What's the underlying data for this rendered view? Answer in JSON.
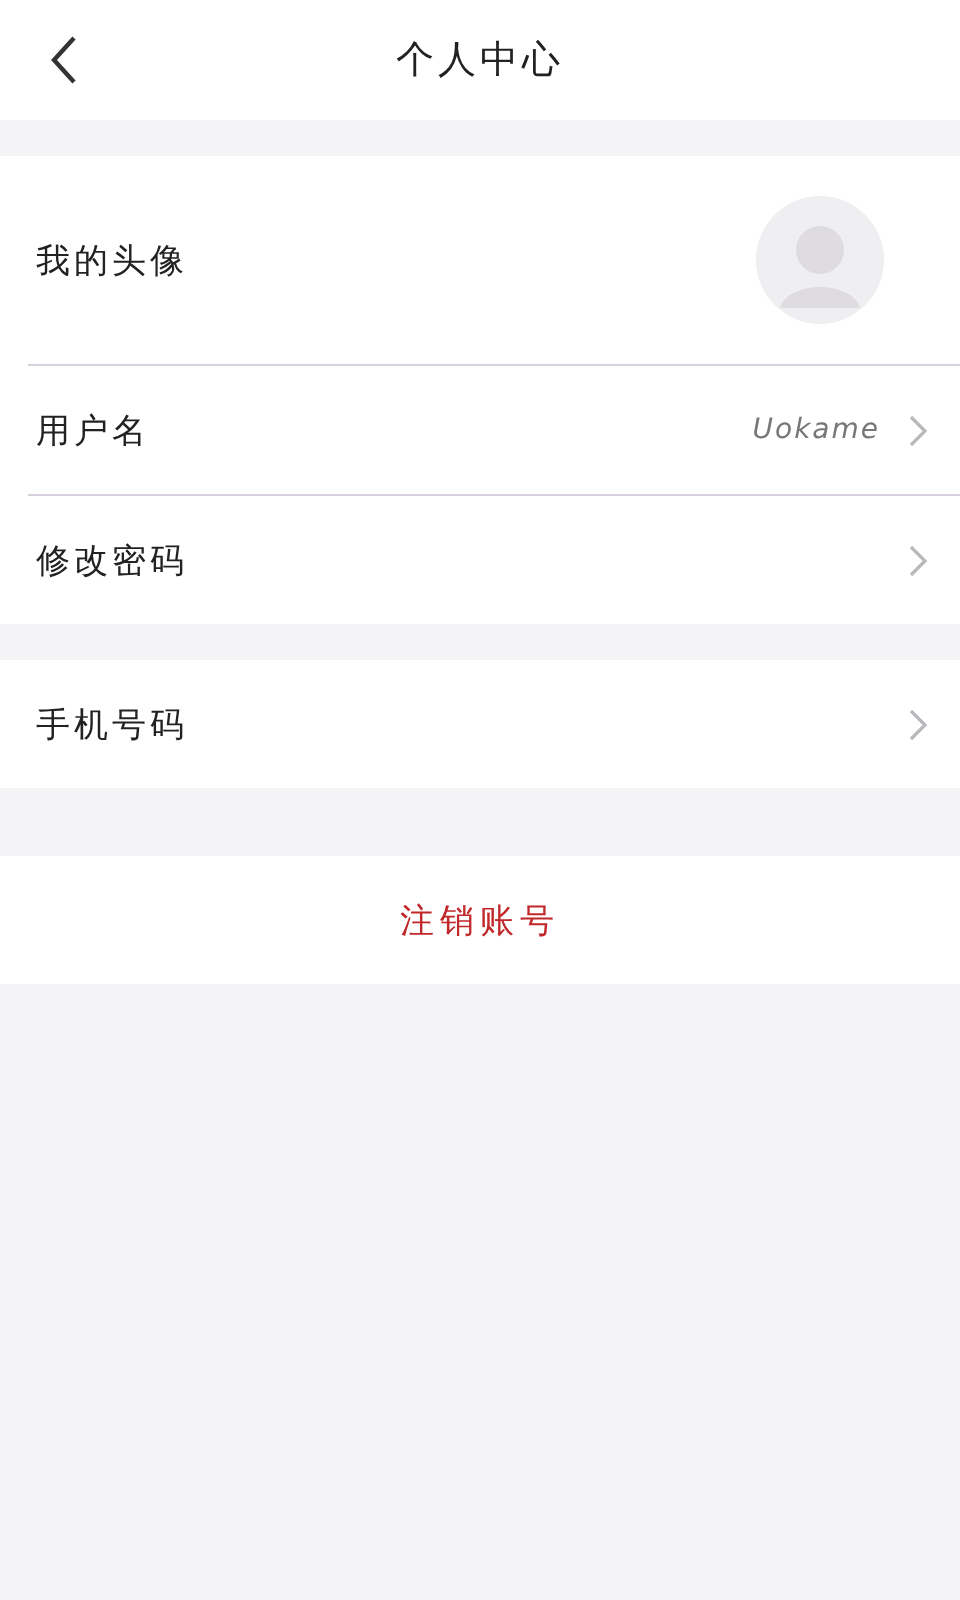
{
  "header": {
    "title": "个人中心"
  },
  "sections": [
    {
      "rows": [
        {
          "kind": "avatar",
          "label": "我的头像"
        },
        {
          "kind": "value",
          "label": "用户名",
          "value": "Uokame"
        },
        {
          "kind": "link",
          "label": "修改密码"
        }
      ]
    },
    {
      "rows": [
        {
          "kind": "link",
          "label": "手机号码"
        }
      ]
    }
  ],
  "logout": {
    "label": "注销账号"
  }
}
